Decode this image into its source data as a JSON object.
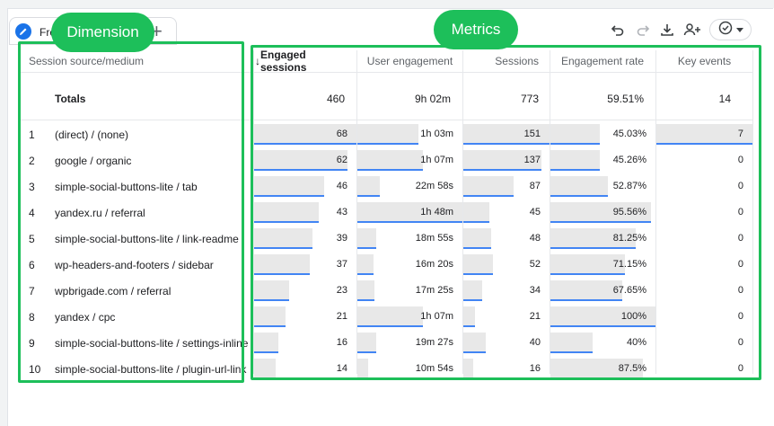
{
  "tab": {
    "label": "Fre"
  },
  "overlay": {
    "dimension_label": "Dimension",
    "metrics_label": "Metrics"
  },
  "toolbar": {
    "icons": [
      "undo-icon",
      "redo-icon",
      "download-icon",
      "share-users-icon",
      "check-circle-icon",
      "caret-down-icon"
    ]
  },
  "colors": {
    "accent": "#1dbf5a",
    "bar_fill": "#e8e8e8",
    "bar_line": "#4285f4",
    "brand": "#1a73e8"
  },
  "table": {
    "dimension_header": "Session source/medium",
    "columns": [
      {
        "label": "Engaged sessions",
        "sorted": true,
        "sort_arrow": "↓"
      },
      {
        "label": "User engagement"
      },
      {
        "label": "Sessions"
      },
      {
        "label": "Engagement rate"
      },
      {
        "label": "Key events"
      }
    ],
    "totals": {
      "label": "Totals",
      "values": [
        "460",
        "9h 02m",
        "773",
        "59.51%",
        "14"
      ]
    },
    "rows": [
      {
        "n": "1",
        "name": "(direct) / (none)",
        "cells": [
          "68",
          "1h 03m",
          "151",
          "45.03%",
          "7"
        ],
        "frac": [
          1.0,
          0.58,
          1.0,
          0.47,
          1.0
        ]
      },
      {
        "n": "2",
        "name": "google / organic",
        "cells": [
          "62",
          "1h 07m",
          "137",
          "45.26%",
          "0"
        ],
        "frac": [
          0.91,
          0.62,
          0.91,
          0.47,
          0
        ]
      },
      {
        "n": "3",
        "name": "simple-social-buttons-lite / tab",
        "cells": [
          "46",
          "22m 58s",
          "87",
          "52.87%",
          "0"
        ],
        "frac": [
          0.68,
          0.21,
          0.58,
          0.55,
          0
        ]
      },
      {
        "n": "4",
        "name": "yandex.ru / referral",
        "cells": [
          "43",
          "1h 48m",
          "45",
          "95.56%",
          "0"
        ],
        "frac": [
          0.63,
          1.0,
          0.3,
          0.96,
          0
        ]
      },
      {
        "n": "5",
        "name": "simple-social-buttons-lite / link-readme",
        "cells": [
          "39",
          "18m 55s",
          "48",
          "81.25%",
          "0"
        ],
        "frac": [
          0.57,
          0.18,
          0.32,
          0.81,
          0
        ]
      },
      {
        "n": "6",
        "name": "wp-headers-and-footers / sidebar",
        "cells": [
          "37",
          "16m 20s",
          "52",
          "71.15%",
          "0"
        ],
        "frac": [
          0.54,
          0.15,
          0.34,
          0.71,
          0
        ]
      },
      {
        "n": "7",
        "name": "wpbrigade.com / referral",
        "cells": [
          "23",
          "17m 25s",
          "34",
          "67.65%",
          "0"
        ],
        "frac": [
          0.34,
          0.16,
          0.22,
          0.68,
          0
        ]
      },
      {
        "n": "8",
        "name": "yandex / cpc",
        "cells": [
          "21",
          "1h 07m",
          "21",
          "100%",
          "0"
        ],
        "frac": [
          0.31,
          0.62,
          0.14,
          1.0,
          0
        ]
      },
      {
        "n": "9",
        "name": "simple-social-buttons-lite / settings-inline",
        "cells": [
          "16",
          "19m 27s",
          "40",
          "40%",
          "0"
        ],
        "frac": [
          0.24,
          0.18,
          0.26,
          0.4,
          0
        ]
      },
      {
        "n": "10",
        "name": "simple-social-buttons-lite / plugin-url-link",
        "cells": [
          "14",
          "10m 54s",
          "16",
          "87.5%",
          "0"
        ],
        "frac": [
          0.21,
          0.1,
          0.11,
          0.88,
          0
        ]
      }
    ]
  }
}
